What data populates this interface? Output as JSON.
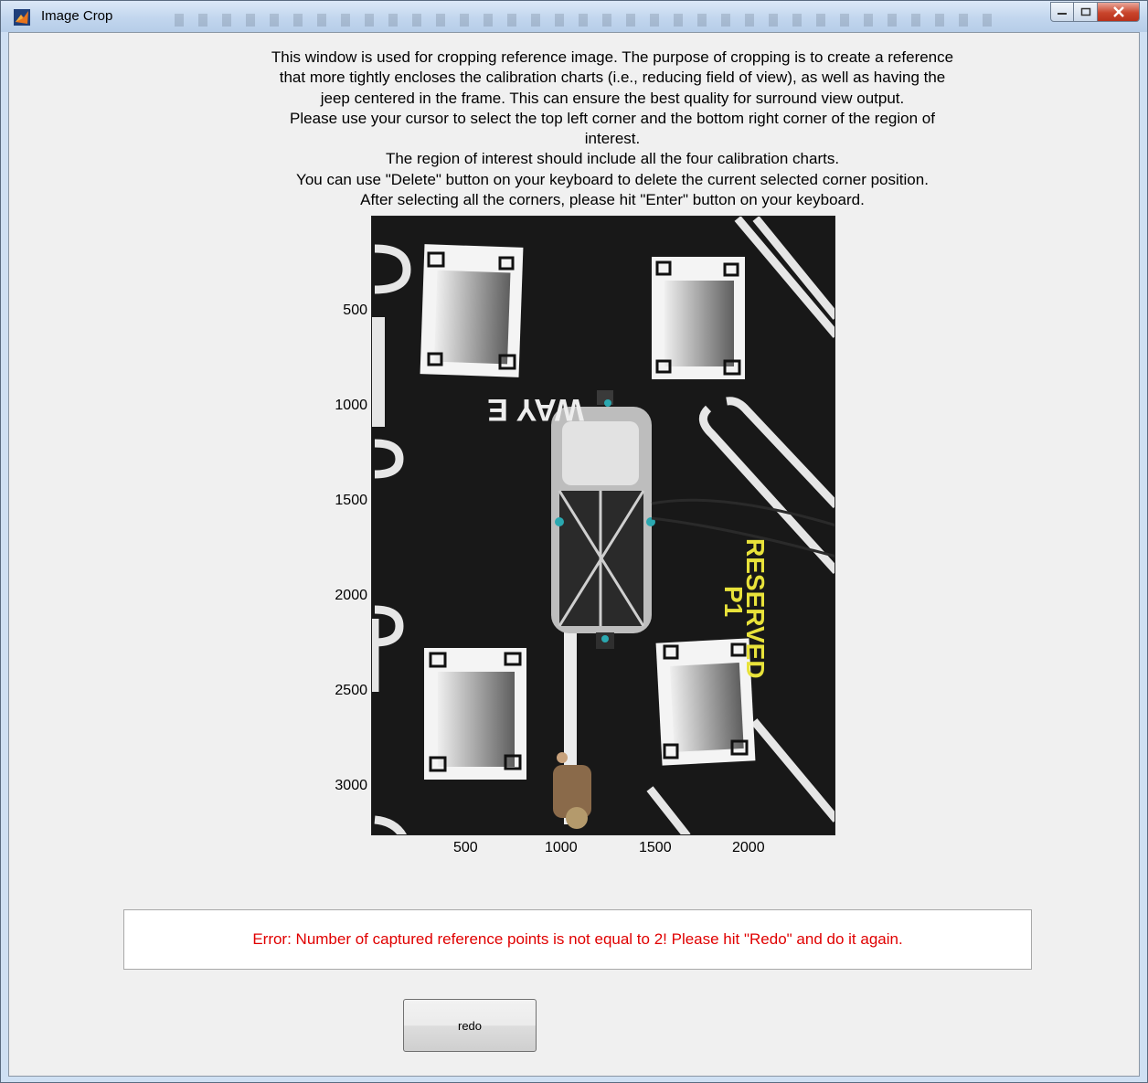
{
  "window": {
    "title": "Image Crop",
    "controls": {
      "minimize": "minimize-icon",
      "maximize": "maximize-icon",
      "close": "close-icon"
    }
  },
  "instructions": [
    "This window is used for cropping reference image. The purpose of cropping is to create a reference",
    "that more tightly encloses the calibration charts (i.e., reducing field of view), as well as having the",
    "jeep centered in the frame. This can ensure the best quality for surround view output.",
    "Please use your cursor to select the top left corner and the bottom right corner of the region of",
    "interest.",
    "The region of interest should include all the four calibration charts.",
    "You can use \"Delete\" button on your keyboard to delete the current selected corner position.",
    "After selecting all the corners, please hit \"Enter\" button on your keyboard."
  ],
  "axes": {
    "x_ticks": [
      "500",
      "1000",
      "1500",
      "2000"
    ],
    "y_ticks": [
      "500",
      "1000",
      "1500",
      "2000",
      "2500",
      "3000"
    ]
  },
  "image": {
    "ground_text_line1": "RESERVED",
    "ground_text_line2": "P1",
    "ground_text_flipped": "WAY E"
  },
  "error": {
    "message": "Error: Number of captured reference points is not equal to 2! Please hit \"Redo\" and do it again."
  },
  "buttons": {
    "redo": "redo"
  },
  "colors": {
    "error": "#e00000",
    "ground_text": "#e8e23a"
  }
}
